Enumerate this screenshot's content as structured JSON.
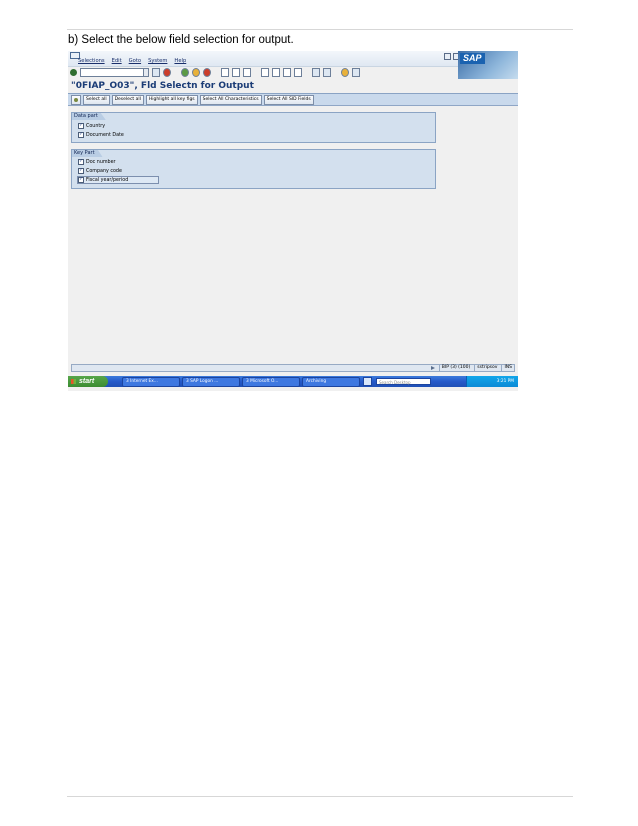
{
  "document": {
    "caption": "b) Select the below field selection for output."
  },
  "sap_window": {
    "menu": [
      "Selections",
      "Edit",
      "Goto",
      "System",
      "Help"
    ],
    "logo": "SAP",
    "screen_title": "\"0FIAP_O03\", Fld Selectn for Output",
    "app_toolbar": {
      "buttons": [
        "Select all",
        "Deselect all",
        "Highlight all key figs",
        "Select All Characteristics",
        "Select All SID Fields"
      ]
    },
    "groups": [
      {
        "title": "Data part",
        "items": [
          {
            "label": "Country",
            "checked": true
          },
          {
            "label": "Document Date",
            "checked": true
          }
        ]
      },
      {
        "title": "Key Part",
        "items": [
          {
            "label": "Doc number",
            "checked": true
          },
          {
            "label": "Company code",
            "checked": true
          },
          {
            "label": "Fiscal year/period",
            "checked": true,
            "focused": true
          }
        ]
      }
    ],
    "status_bar": {
      "system": "BIP (3) (100)",
      "server": "sstripsov",
      "mode": "INS"
    }
  },
  "taskbar": {
    "start": "start",
    "tasks": [
      "3 Internet Ex...",
      "3 SAP Logon ...",
      "3 Microsoft O...",
      "Archiving"
    ],
    "search_placeholder": "Search Desktop",
    "clock": "3:21 PM"
  },
  "colors": {
    "group_background": "#d3e0ee",
    "title_text": "#1b3c76",
    "taskbar_blue": "#2559c9",
    "start_green": "#3b8c31"
  }
}
